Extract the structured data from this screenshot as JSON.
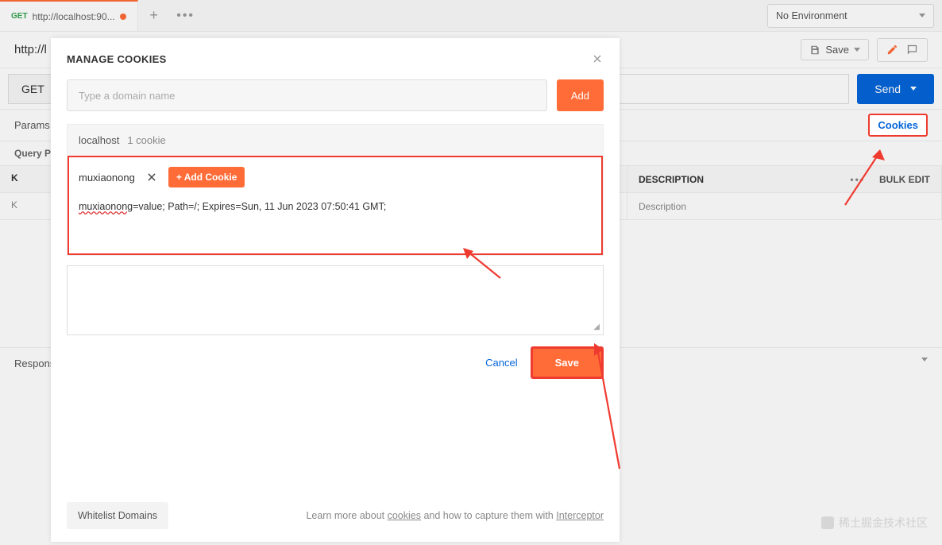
{
  "tabs": {
    "active": {
      "method": "GET",
      "url": "http://localhost:90..."
    }
  },
  "env": {
    "label": "No Environment"
  },
  "title": {
    "url": "http://l"
  },
  "toolbar": {
    "save_label": "Save"
  },
  "request": {
    "method": "GET",
    "send_label": "Send"
  },
  "subtabs": {
    "params": "Params",
    "cookies": "Cookies"
  },
  "query": {
    "heading": "Query P"
  },
  "table": {
    "headers": {
      "key": "K",
      "value": "",
      "description": "DESCRIPTION",
      "bulk": "Bulk Edit"
    },
    "row": {
      "key": "K",
      "value": "",
      "description": "Description"
    }
  },
  "response": {
    "label": "Respons"
  },
  "modal": {
    "title": "MANAGE COOKIES",
    "domain_placeholder": "Type a domain name",
    "add": "Add",
    "domain": "localhost",
    "count": "1 cookie",
    "cookie_name": "muxiaonong",
    "add_cookie": "+ Add Cookie",
    "cookie_value_name": "muxiaonong",
    "cookie_value_rest": "=value; Path=/; Expires=Sun, 11 Jun 2023 07:50:41 GMT;",
    "cancel": "Cancel",
    "save": "Save",
    "whitelist": "Whitelist Domains",
    "learn_pre": "Learn more about ",
    "learn_link1": "cookies",
    "learn_mid": " and how to capture them with ",
    "learn_link2": "Interceptor"
  },
  "watermark": "稀土掘金技术社区"
}
